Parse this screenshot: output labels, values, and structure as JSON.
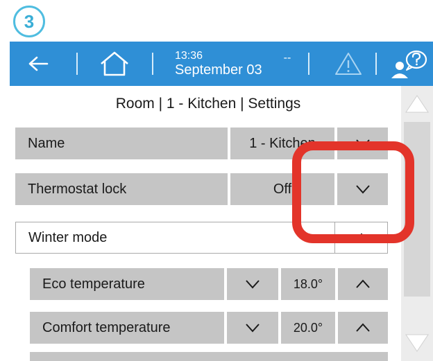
{
  "step": {
    "number": "3"
  },
  "topbar": {
    "back_icon": "arrow-left-icon",
    "home_icon": "home-icon",
    "time": "13:36",
    "date": "September 03",
    "status": "--",
    "warning_icon": "warning-icon",
    "help_icon": "user-help-icon",
    "bg_color": "#2f8fd6"
  },
  "page": {
    "title": "Room | 1 - Kitchen | Settings"
  },
  "rows": {
    "name": {
      "label": "Name",
      "value": "1 - Kitchen",
      "button_icon": "chevron-down-icon"
    },
    "lock": {
      "label": "Thermostat lock",
      "value": "Off",
      "button_icon": "chevron-down-icon"
    },
    "winter": {
      "label": "Winter mode",
      "button_icon": "chevron-up-icon"
    },
    "eco": {
      "label": "Eco temperature",
      "value": "18.0°",
      "down_icon": "chevron-down-icon",
      "up_icon": "chevron-up-icon"
    },
    "comfort": {
      "label": "Comfort temperature",
      "value": "20.0°",
      "down_icon": "chevron-down-icon",
      "up_icon": "chevron-up-icon"
    }
  },
  "scrollbar": {
    "up_icon": "triangle-up-icon",
    "down_icon": "triangle-down-icon"
  },
  "annotation": {
    "color": "#e3342a",
    "badge_color": "#4fbde0"
  }
}
